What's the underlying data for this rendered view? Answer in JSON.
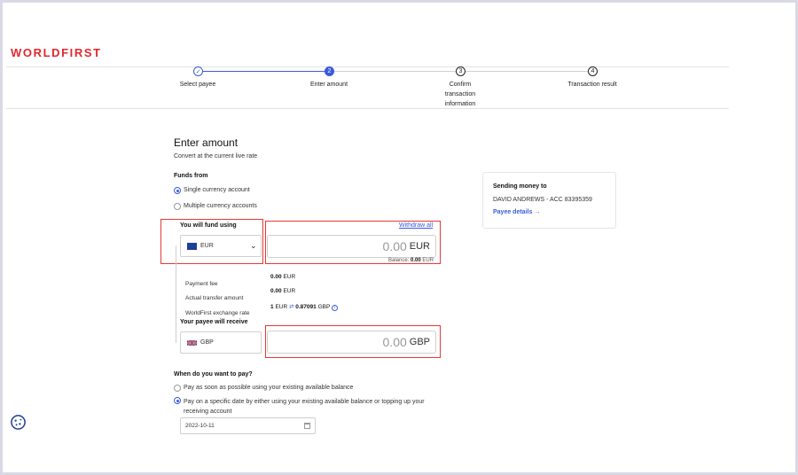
{
  "brand": {
    "logo_text": "WORLDFIRST"
  },
  "stepper": {
    "steps": [
      {
        "number": "✓",
        "label": "Select payee",
        "state": "done"
      },
      {
        "number": "2",
        "label": "Enter amount",
        "state": "active"
      },
      {
        "number": "3",
        "label_lines": [
          "Confirm",
          "transaction",
          "information"
        ],
        "state": "pending"
      },
      {
        "number": "4",
        "label": "Transaction result",
        "state": "pending"
      }
    ]
  },
  "page": {
    "title": "Enter amount",
    "subtitle": "Convert at the current live rate"
  },
  "funds_from": {
    "label": "Funds from",
    "options": [
      {
        "label": "Single currency account",
        "selected": true
      },
      {
        "label": "Multiple currency accounts",
        "selected": false
      }
    ]
  },
  "fund_using": {
    "label": "You will fund using",
    "currency": "EUR",
    "withdraw_all": "Withdraw all",
    "amount": "0.00",
    "amount_currency": "EUR",
    "balance_label": "Balance:",
    "balance_value": "0.00",
    "balance_currency": "EUR"
  },
  "details": {
    "payment_fee_label": "Payment fee",
    "payment_fee_value": "0.00",
    "payment_fee_currency": "EUR",
    "transfer_label": "Actual transfer amount",
    "transfer_value": "0.00",
    "transfer_currency": "EUR",
    "rate_label": "WorldFirst exchange rate",
    "rate_from_amount": "1",
    "rate_from_currency": "EUR",
    "rate_swap_icon": "⇄",
    "rate_to_amount": "0.87091",
    "rate_to_currency": "GBP",
    "rate_info_icon": "i"
  },
  "payee_receive": {
    "label": "Your payee will receive",
    "currency": "GBP",
    "amount": "0.00",
    "amount_currency": "GBP"
  },
  "when_to_pay": {
    "label": "When do you want to pay?",
    "options": [
      {
        "label": "Pay as soon as possible using your existing available balance",
        "selected": false
      },
      {
        "label_lines": [
          "Pay on a specific date by either using your existing available balance or topping up your",
          "receiving account"
        ],
        "selected": true
      }
    ],
    "date_value": "2022-10-11"
  },
  "sending_card": {
    "title": "Sending money to",
    "payee": "DAVID ANDREWS - ACC 83395359",
    "details_link": "Payee details",
    "details_arrow": "→"
  },
  "colors": {
    "brand_red": "#e0282e",
    "accent_blue": "#3b5bdb",
    "highlight_red": "#e53935"
  }
}
